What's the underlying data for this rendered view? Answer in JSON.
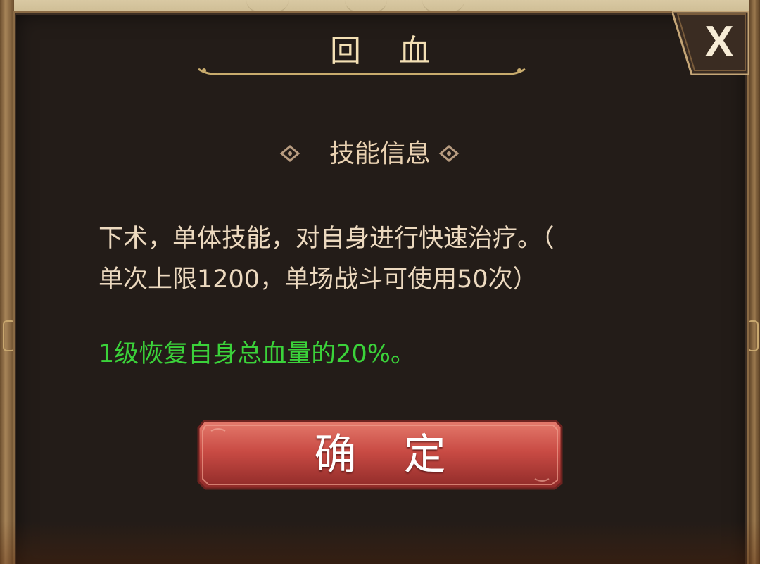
{
  "dialog": {
    "title": "回 血",
    "close_label": "X",
    "section_title": "技能信息",
    "description": "下术，单体技能，对自身进行快速治疗。（\n单次上限1200，单场战斗可使用50次）",
    "effect": "1级恢复自身总血量的20%。",
    "confirm_label": "确 定"
  },
  "colors": {
    "dialog_bg": "#231c18",
    "title_text": "#f3dfb4",
    "body_text": "#ecd9bf",
    "effect_text": "#3bd23a",
    "button_red": "#c94b44",
    "frame_gold": "#8a6a44"
  },
  "icons": {
    "close": "close-x-icon",
    "title_ornament": "scroll-ornament-icon",
    "section_ornament": "diamond-ornament-icon"
  }
}
